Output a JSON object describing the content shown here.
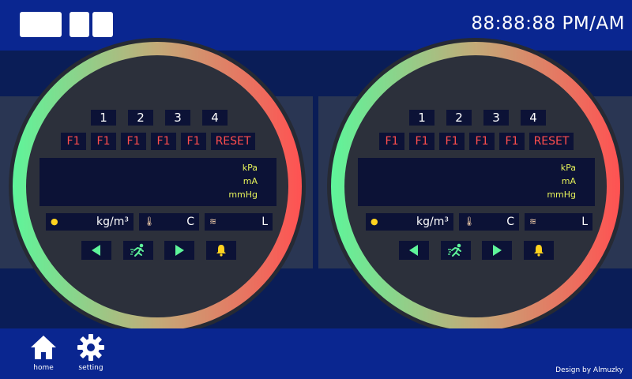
{
  "header": {
    "clock": "88:88:88 PM/AM"
  },
  "gauges": [
    {
      "channels": [
        "1",
        "2",
        "3",
        "4"
      ],
      "faults": [
        "F1",
        "F1",
        "F1",
        "F1",
        "F1"
      ],
      "reset_label": "RESET",
      "units": [
        "kPa",
        "mA",
        "mmHg"
      ],
      "density_unit": "kg/m³",
      "temp_unit": "C",
      "flow_unit": "L"
    },
    {
      "channels": [
        "1",
        "2",
        "3",
        "4"
      ],
      "faults": [
        "F1",
        "F1",
        "F1",
        "F1",
        "F1"
      ],
      "reset_label": "RESET",
      "units": [
        "kPa",
        "mA",
        "mmHg"
      ],
      "density_unit": "kg/m³",
      "temp_unit": "C",
      "flow_unit": "L"
    }
  ],
  "nav": {
    "home_label": "home",
    "setting_label": "setting"
  },
  "footer": {
    "credit": "Design by Almuzky"
  },
  "colors": {
    "ring_start": "#5ef59a",
    "ring_end": "#ff5252",
    "fault_red": "#ff4d4d",
    "unit_yellow": "#e6f25a",
    "accent_green": "#5ef59a",
    "bell_yellow": "#ffd21f"
  },
  "icons": [
    "drop-icon",
    "thermometer-icon",
    "flow-icon",
    "arrow-left-icon",
    "runner-icon",
    "arrow-right-icon",
    "bell-icon",
    "home-icon",
    "gear-icon"
  ]
}
